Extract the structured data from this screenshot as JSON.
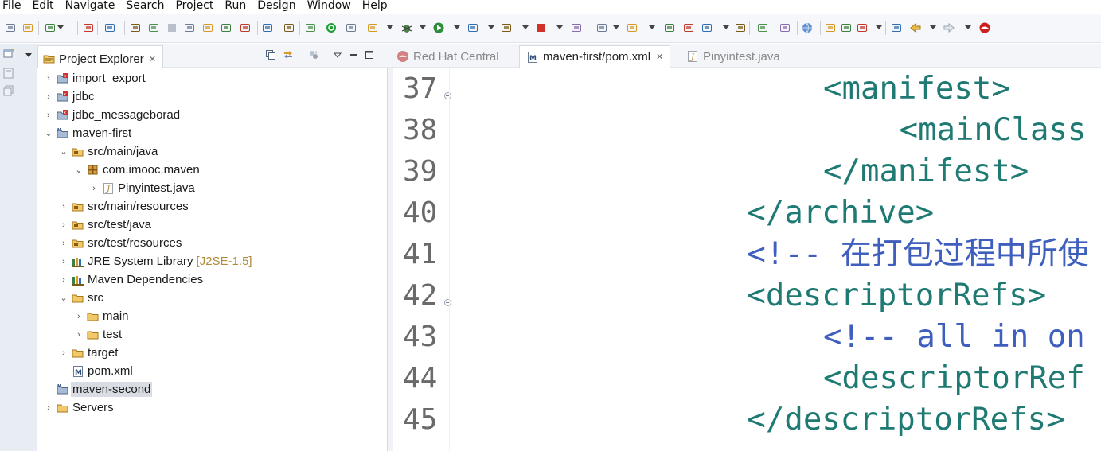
{
  "menu": [
    "File",
    "Edit",
    "Navigate",
    "Search",
    "Project",
    "Run",
    "Design",
    "Window",
    "Help"
  ],
  "toolbar_icons": [
    "new-icon",
    "save-icon",
    "profile-icon",
    "console-icon",
    "skip-breakpoints-icon",
    "resume-icon",
    "suspend-icon",
    "terminate-icon",
    "disconnect-icon",
    "step-into-icon",
    "step-over-icon",
    "step-return-icon",
    "drop-to-frame-icon",
    "use-step-filters-icon",
    "open-type-icon",
    "server-start-icon",
    "server-status-icon",
    "toggle-mark-occurrences-icon",
    "debug-icon",
    "run-icon",
    "coverage-icon",
    "run-external-tool-icon",
    "stop-icon",
    "run-last-tool-icon",
    "spell-check-icon",
    "new-java-project-icon",
    "new-package-icon",
    "new-class-icon",
    "open-folder-icon",
    "deploy-icon",
    "open-task-icon",
    "search-icon",
    "web-browser-icon",
    "annotation-icon",
    "next-annotation-icon",
    "previous-annotation-icon",
    "last-edit-location-icon",
    "back-icon",
    "forward-icon",
    "redhat-icon"
  ],
  "project_explorer": {
    "title": "Project Explorer",
    "tree": [
      {
        "label": "import_export",
        "depth": 0,
        "expanded": false,
        "icon": "project-icon"
      },
      {
        "label": "jdbc",
        "depth": 0,
        "expanded": false,
        "icon": "project-icon"
      },
      {
        "label": "jdbc_messageborad",
        "depth": 0,
        "expanded": false,
        "icon": "project-icon"
      },
      {
        "label": "maven-first",
        "depth": 0,
        "expanded": true,
        "icon": "maven-project-icon"
      },
      {
        "label": "src/main/java",
        "depth": 1,
        "expanded": true,
        "icon": "source-folder-icon"
      },
      {
        "label": "com.imooc.maven",
        "depth": 2,
        "expanded": true,
        "icon": "package-icon"
      },
      {
        "label": "Pinyintest.java",
        "depth": 3,
        "expanded": false,
        "icon": "java-file-icon"
      },
      {
        "label": "src/main/resources",
        "depth": 1,
        "expanded": false,
        "icon": "source-folder-icon"
      },
      {
        "label": "src/test/java",
        "depth": 1,
        "expanded": false,
        "icon": "source-folder-icon"
      },
      {
        "label": "src/test/resources",
        "depth": 1,
        "expanded": false,
        "icon": "source-folder-icon"
      },
      {
        "label": "JRE System Library",
        "decoration": "[J2SE-1.5]",
        "depth": 1,
        "expanded": false,
        "icon": "library-icon"
      },
      {
        "label": "Maven Dependencies",
        "depth": 1,
        "expanded": false,
        "icon": "library-icon"
      },
      {
        "label": "src",
        "depth": 1,
        "expanded": true,
        "icon": "folder-icon"
      },
      {
        "label": "main",
        "depth": 2,
        "expanded": false,
        "icon": "folder-icon"
      },
      {
        "label": "test",
        "depth": 2,
        "expanded": false,
        "icon": "folder-icon"
      },
      {
        "label": "target",
        "depth": 1,
        "expanded": false,
        "icon": "folder-icon"
      },
      {
        "label": "pom.xml",
        "depth": 1,
        "expanded": null,
        "icon": "maven-file-icon"
      },
      {
        "label": "maven-second",
        "depth": 0,
        "expanded": null,
        "icon": "maven-project-icon",
        "selected": true
      },
      {
        "label": "Servers",
        "depth": 0,
        "expanded": false,
        "icon": "folder-icon"
      }
    ]
  },
  "editor": {
    "tabs": [
      {
        "label": "Red Hat Central",
        "active": false,
        "icon": "redhat-icon"
      },
      {
        "label": "maven-first/pom.xml",
        "active": true,
        "icon": "maven-file-icon"
      },
      {
        "label": "Pinyintest.java",
        "active": false,
        "icon": "java-file-icon"
      }
    ],
    "lines": [
      {
        "num": "37",
        "indent": 20,
        "text": "<manifest>",
        "kind": "tag",
        "fold": true
      },
      {
        "num": "38",
        "indent": 24,
        "text": "<mainClass",
        "kind": "tag",
        "fold": false
      },
      {
        "num": "39",
        "indent": 20,
        "text": "</manifest>",
        "kind": "tag",
        "fold": false
      },
      {
        "num": "40",
        "indent": 16,
        "text": "</archive>",
        "kind": "tag",
        "fold": false
      },
      {
        "num": "41",
        "indent": 16,
        "text": "<!-- 在打包过程中所使",
        "kind": "comment",
        "fold": false
      },
      {
        "num": "42",
        "indent": 16,
        "text": "<descriptorRefs>",
        "kind": "tag",
        "fold": true
      },
      {
        "num": "43",
        "indent": 20,
        "text": "<!-- all in on",
        "kind": "comment",
        "fold": false
      },
      {
        "num": "44",
        "indent": 20,
        "text": "<descriptorRef",
        "kind": "tag",
        "fold": false
      },
      {
        "num": "45",
        "indent": 16,
        "text": "</descriptorRefs>",
        "kind": "tag",
        "fold": false
      }
    ]
  },
  "colors": {
    "tag": "#1f7a73",
    "comment": "#3f5fbf",
    "line_number": "#6a6a6a",
    "selection": "#d9dde3"
  }
}
